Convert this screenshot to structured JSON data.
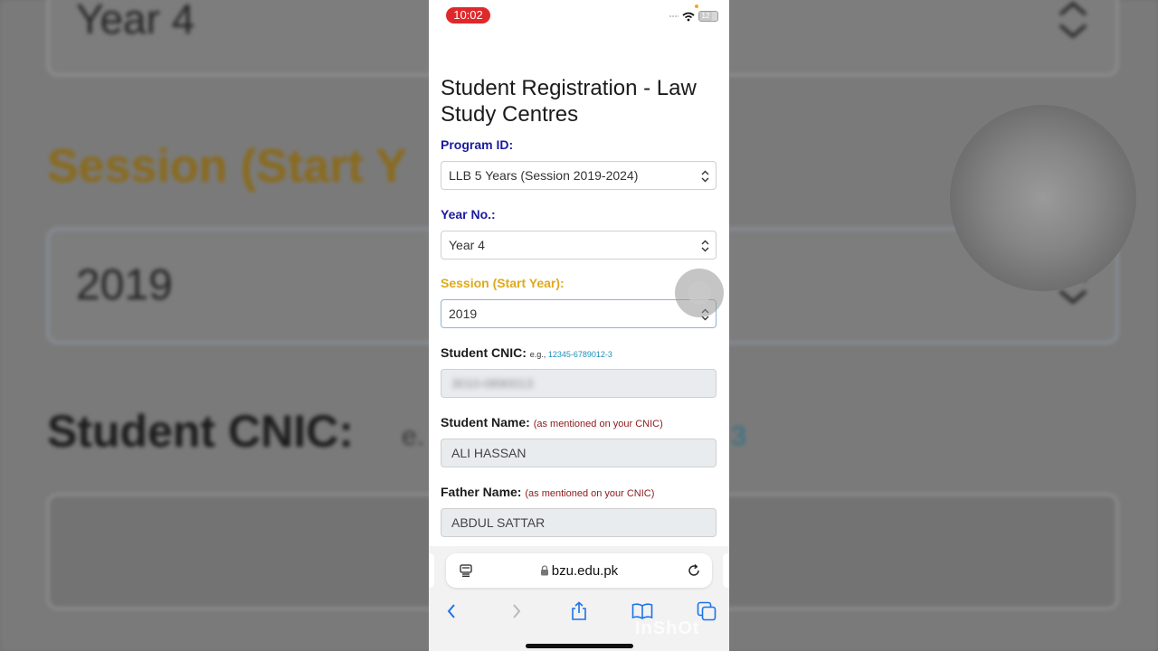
{
  "status_bar": {
    "time": "10:02",
    "battery": "12"
  },
  "page": {
    "title": "Student Registration - Law Study Centres"
  },
  "form": {
    "program": {
      "label": "Program ID:",
      "value": "LLB 5 Years (Session 2019-2024)"
    },
    "year": {
      "label": "Year No.:",
      "value": "Year 4"
    },
    "session": {
      "label": "Session (Start Year):",
      "value": "2019"
    },
    "cnic": {
      "label": "Student CNIC:",
      "hint_prefix": "e.g.,",
      "hint_example": "12345-6789012-3",
      "value": "3010-0890013"
    },
    "student_name": {
      "label": "Student Name:",
      "hint": "(as mentioned on your CNIC)",
      "value": "ALI HASSAN"
    },
    "father_name": {
      "label": "Father Name:",
      "hint": "(as mentioned on your CNIC)",
      "value": "ABDUL SATTAR"
    }
  },
  "browser": {
    "url": "bzu.edu.pk",
    "watermark": "InShOt"
  },
  "background": {
    "year_value": "Year 4",
    "session_label": "Session (Start Y",
    "session_value": "2019",
    "cnic_label": "Student CNIC:",
    "cnic_hint_prefix": "e.",
    "cnic_hint_tail": "3"
  },
  "colors": {
    "label_blue": "#1a1aa0",
    "label_amber": "#e0a91c",
    "hint_red": "#8b1a1a",
    "example_link": "#1e8fb5",
    "time_pill": "#e0282b"
  },
  "icons": [
    "wifi-icon",
    "battery-icon",
    "chevron-updown-icon",
    "tabs-overview-icon",
    "lock-icon",
    "reload-icon",
    "back-icon",
    "forward-icon",
    "share-icon",
    "bookmarks-icon",
    "tabs-icon"
  ]
}
